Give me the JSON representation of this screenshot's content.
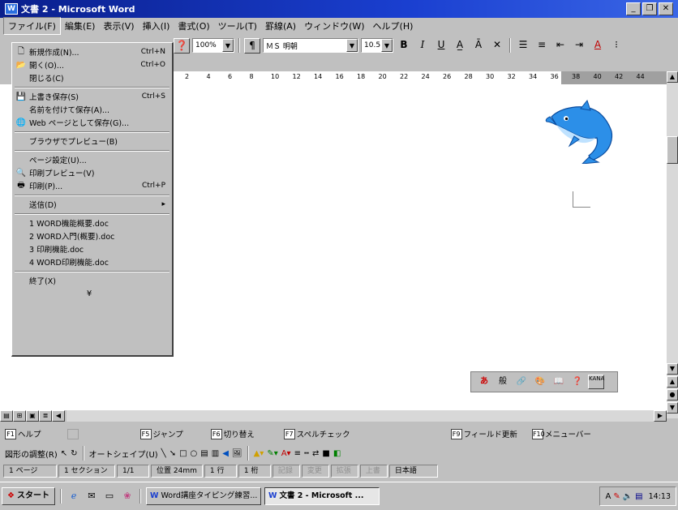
{
  "window": {
    "title": "文書 2 - Microsoft Word"
  },
  "menubar": [
    "ファイル(F)",
    "編集(E)",
    "表示(V)",
    "挿入(I)",
    "書式(O)",
    "ツール(T)",
    "罫線(A)",
    "ウィンドウ(W)",
    "ヘルプ(H)"
  ],
  "toolbar": {
    "zoom": "100%",
    "font": "ＭＳ 明朝",
    "size": "10.5"
  },
  "ruler": [
    "2",
    "4",
    "6",
    "8",
    "10",
    "12",
    "14",
    "16",
    "18",
    "20",
    "22",
    "24",
    "26",
    "28",
    "30",
    "32",
    "34",
    "36",
    "38",
    "40",
    "42",
    "44"
  ],
  "file_menu": {
    "items": [
      {
        "icon": "new-doc-icon",
        "glyph": "🗋",
        "label": "新規作成(N)...",
        "shortcut": "Ctrl+N"
      },
      {
        "icon": "open-folder-icon",
        "glyph": "📂",
        "label": "開く(O)...",
        "shortcut": "Ctrl+O"
      },
      {
        "icon": "",
        "glyph": "",
        "label": "閉じる(C)",
        "shortcut": ""
      },
      {
        "sep": true
      },
      {
        "icon": "save-icon",
        "glyph": "💾",
        "label": "上書き保存(S)",
        "shortcut": "Ctrl+S"
      },
      {
        "icon": "",
        "glyph": "",
        "label": "名前を付けて保存(A)...",
        "shortcut": ""
      },
      {
        "icon": "web-page-icon",
        "glyph": "🌐",
        "label": "Web ページとして保存(G)...",
        "shortcut": ""
      },
      {
        "sep": true
      },
      {
        "icon": "",
        "glyph": "",
        "label": "ブラウザでプレビュー(B)",
        "shortcut": ""
      },
      {
        "sep": true
      },
      {
        "icon": "",
        "glyph": "",
        "label": "ページ設定(U)...",
        "shortcut": ""
      },
      {
        "icon": "print-preview-icon",
        "glyph": "🔍",
        "label": "印刷プレビュー(V)",
        "shortcut": ""
      },
      {
        "icon": "printer-icon",
        "glyph": "🖶",
        "label": "印刷(P)...",
        "shortcut": "Ctrl+P"
      },
      {
        "sep": true
      },
      {
        "icon": "",
        "glyph": "",
        "label": "送信(D)",
        "shortcut": "▸"
      },
      {
        "sep": true
      },
      {
        "icon": "",
        "glyph": "",
        "label": "1 WORD機能概要.doc",
        "shortcut": ""
      },
      {
        "icon": "",
        "glyph": "",
        "label": "2 WORD入門(概要).doc",
        "shortcut": ""
      },
      {
        "icon": "",
        "glyph": "",
        "label": "3 印刷機能.doc",
        "shortcut": ""
      },
      {
        "icon": "",
        "glyph": "",
        "label": "4 WORD印刷機能.doc",
        "shortcut": ""
      },
      {
        "sep": true
      },
      {
        "icon": "",
        "glyph": "",
        "label": "終了(X)",
        "shortcut": ""
      },
      {
        "icon": "expand-chevron-icon",
        "glyph": "¥",
        "label": "",
        "shortcut": ""
      }
    ]
  },
  "assist_row": [
    {
      "label": "ヘルプ",
      "key": "F1",
      "dim": false
    },
    {
      "label": "",
      "key": "",
      "dim": true
    },
    {
      "label": "ジャンプ",
      "key": "F5",
      "dim": false
    },
    {
      "label": "切り替え",
      "key": "F6",
      "dim": false
    },
    {
      "label": "スペルチェック",
      "key": "F7",
      "dim": false
    },
    {
      "label": "フィールド更新",
      "key": "F9",
      "dim": false
    },
    {
      "label": "メニューバー",
      "key": "F10",
      "dim": false
    }
  ],
  "draw_toolbar": {
    "draw": "図形の調整(R)",
    "autoshape": "オートシェイプ(U)"
  },
  "status": [
    "1 ページ",
    "1 セクション",
    "1/1",
    "位置 24mm",
    "1 行",
    "1 桁",
    "記録",
    "変更",
    "拡張",
    "上書",
    "日本語"
  ],
  "taskbar": {
    "start": "スタート",
    "tasks": [
      {
        "label": "Word講座タイピング練習...",
        "active": false
      },
      {
        "label": "文書 2 - Microsoft ...",
        "active": true
      }
    ],
    "clock": "14:13"
  },
  "ime": {
    "keys": [
      "あ",
      "般",
      "🔗",
      "🎨",
      "📖",
      "❓",
      "KANA"
    ]
  }
}
